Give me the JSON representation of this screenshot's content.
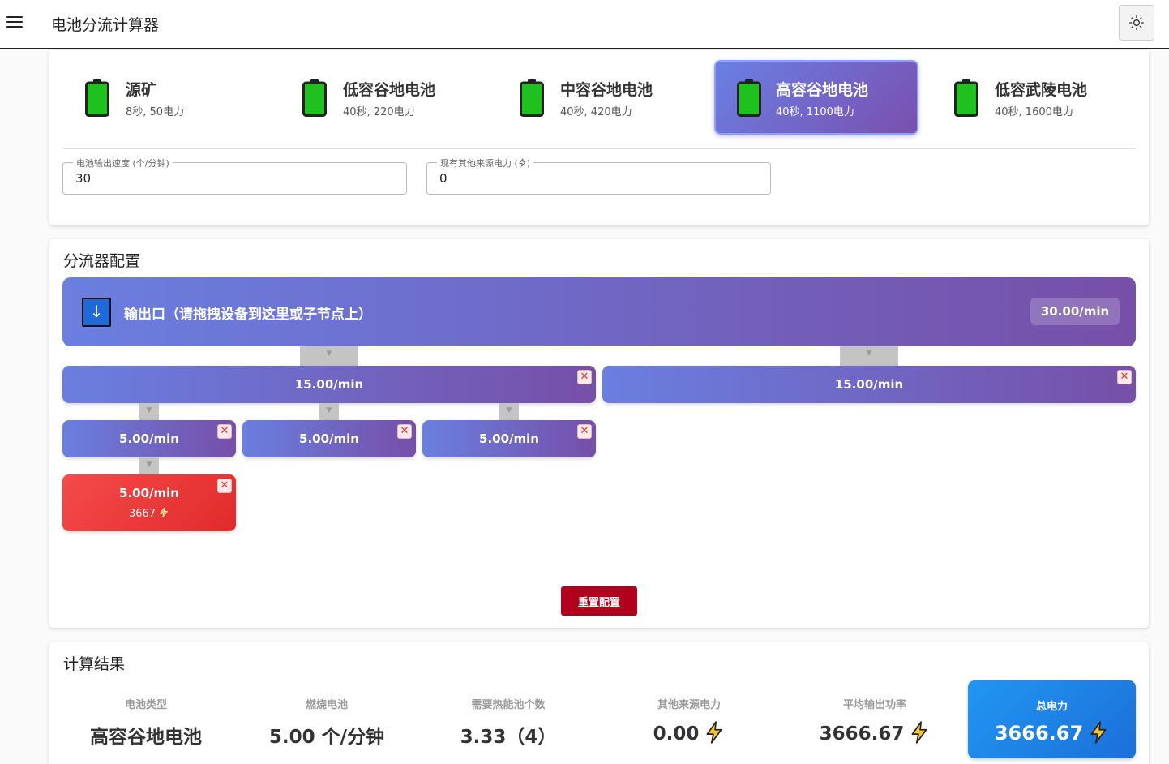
{
  "header": {
    "title": "电池分流计算器"
  },
  "batteries": [
    {
      "name": "源矿",
      "desc": "8秒, 50电力",
      "selected": false
    },
    {
      "name": "低容谷地电池",
      "desc": "40秒, 220电力",
      "selected": false
    },
    {
      "name": "中容谷地电池",
      "desc": "40秒, 420电力",
      "selected": false
    },
    {
      "name": "高容谷地电池",
      "desc": "40秒, 1100电力",
      "selected": true
    },
    {
      "name": "低容武陵电池",
      "desc": "40秒, 1600电力",
      "selected": false
    }
  ],
  "inputs": {
    "output_speed_label": "电池输出速度 (个/分钟)",
    "output_speed_value": "30",
    "other_power_label": "现有其他来源电力 (",
    "other_power_label_end": ")",
    "other_power_value": "0"
  },
  "splitter": {
    "title": "分流器配置",
    "output_label": "输出口（请拖拽设备到这里或子节点上）",
    "output_rate": "30.00/min",
    "level1": [
      {
        "rate": "15.00/min"
      },
      {
        "rate": "15.00/min"
      }
    ],
    "level2": [
      {
        "rate": "5.00/min"
      },
      {
        "rate": "5.00/min"
      },
      {
        "rate": "5.00/min"
      }
    ],
    "level3": [
      {
        "rate": "5.00/min",
        "power": "3667"
      }
    ],
    "close_symbol": "✕",
    "arrow_symbol": "▼",
    "out_arrow": "↓",
    "reset_label": "重置配置"
  },
  "results": {
    "title": "计算结果",
    "stats": [
      {
        "label": "电池类型",
        "value": "高容谷地电池",
        "bolt": false
      },
      {
        "label": "燃烧电池",
        "value": "5.00 个/分钟",
        "bolt": false
      },
      {
        "label": "需要热能池个数",
        "value": "3.33（4）",
        "bolt": false
      },
      {
        "label": "其他来源电力",
        "value": "0.00",
        "bolt": true
      },
      {
        "label": "平均输出功率",
        "value": "3666.67",
        "bolt": true
      }
    ],
    "total_label": "总电力",
    "total_value": "3666.67"
  },
  "colors": {
    "accent_gradient_start": "#6a7fe0",
    "accent_gradient_end": "#764fa8",
    "battery_green": "#1fc11f",
    "danger": "#e12a2a",
    "reset_button": "#b0001e",
    "total_blue": "#2196f3"
  },
  "icons": {
    "menu": "menu-icon",
    "theme": "sun-icon",
    "battery": "battery-icon",
    "bolt": "lightning-icon",
    "output": "arrow-down-icon",
    "close": "close-icon"
  }
}
